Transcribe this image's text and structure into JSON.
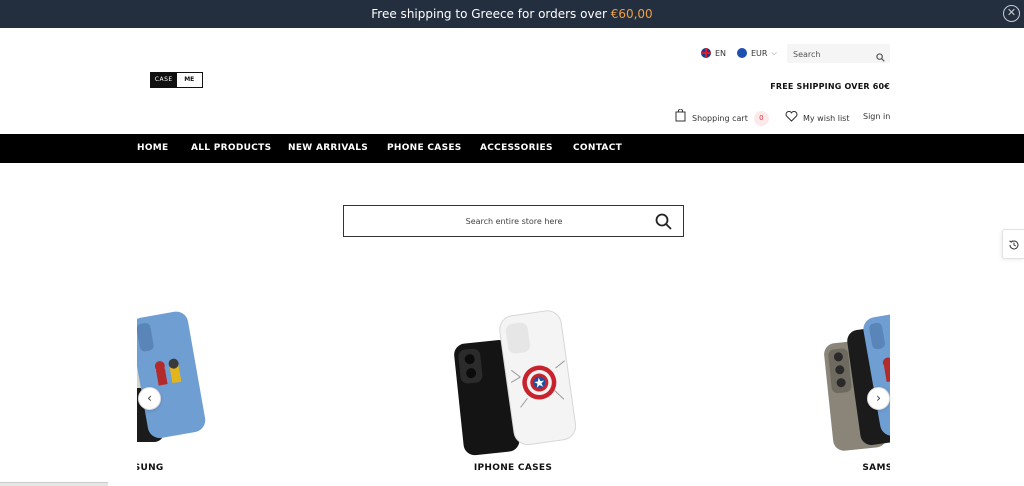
{
  "announcement": {
    "text": "Free shipping to Greece for orders over ",
    "amount": "€60,00",
    "close_icon": "close-icon"
  },
  "header": {
    "logo": {
      "left": "CASE",
      "right": "ME"
    },
    "language": {
      "label": "EN",
      "icon": "uk-flag-icon"
    },
    "currency": {
      "label": "EUR",
      "icon": "eu-flag-icon"
    },
    "search": {
      "placeholder": "Search",
      "icon": "search-icon"
    },
    "free_shipping": "FREE SHIPPING OVER 60€",
    "cart": {
      "label": "Shopping cart",
      "count": "0",
      "icon": "shopping-bag-icon"
    },
    "wishlist": {
      "label": "My wish list",
      "icon": "heart-icon"
    },
    "signin": "Sign in"
  },
  "nav": {
    "items": [
      "HOME",
      "ALL PRODUCTS",
      "NEW ARRIVALS",
      "PHONE CASES",
      "ACCESSORIES",
      "CONTACT"
    ]
  },
  "main_search": {
    "placeholder": "Search entire store here",
    "icon": "search-icon"
  },
  "recent_tab": {
    "icon": "history-icon"
  },
  "carousel": {
    "slides": [
      {
        "label": "SAMSUNG"
      },
      {
        "label": "IPHONE CASES"
      },
      {
        "label": "SAMSUNG"
      }
    ],
    "prev_icon": "chevron-left-icon",
    "next_icon": "chevron-right-icon"
  },
  "colors": {
    "announcement_bg": "#232f3e",
    "accent_amount": "#f0a040",
    "nav_bg": "#000000",
    "cart_badge_bg": "#fde9ea",
    "cart_badge_text": "#dd3333"
  }
}
